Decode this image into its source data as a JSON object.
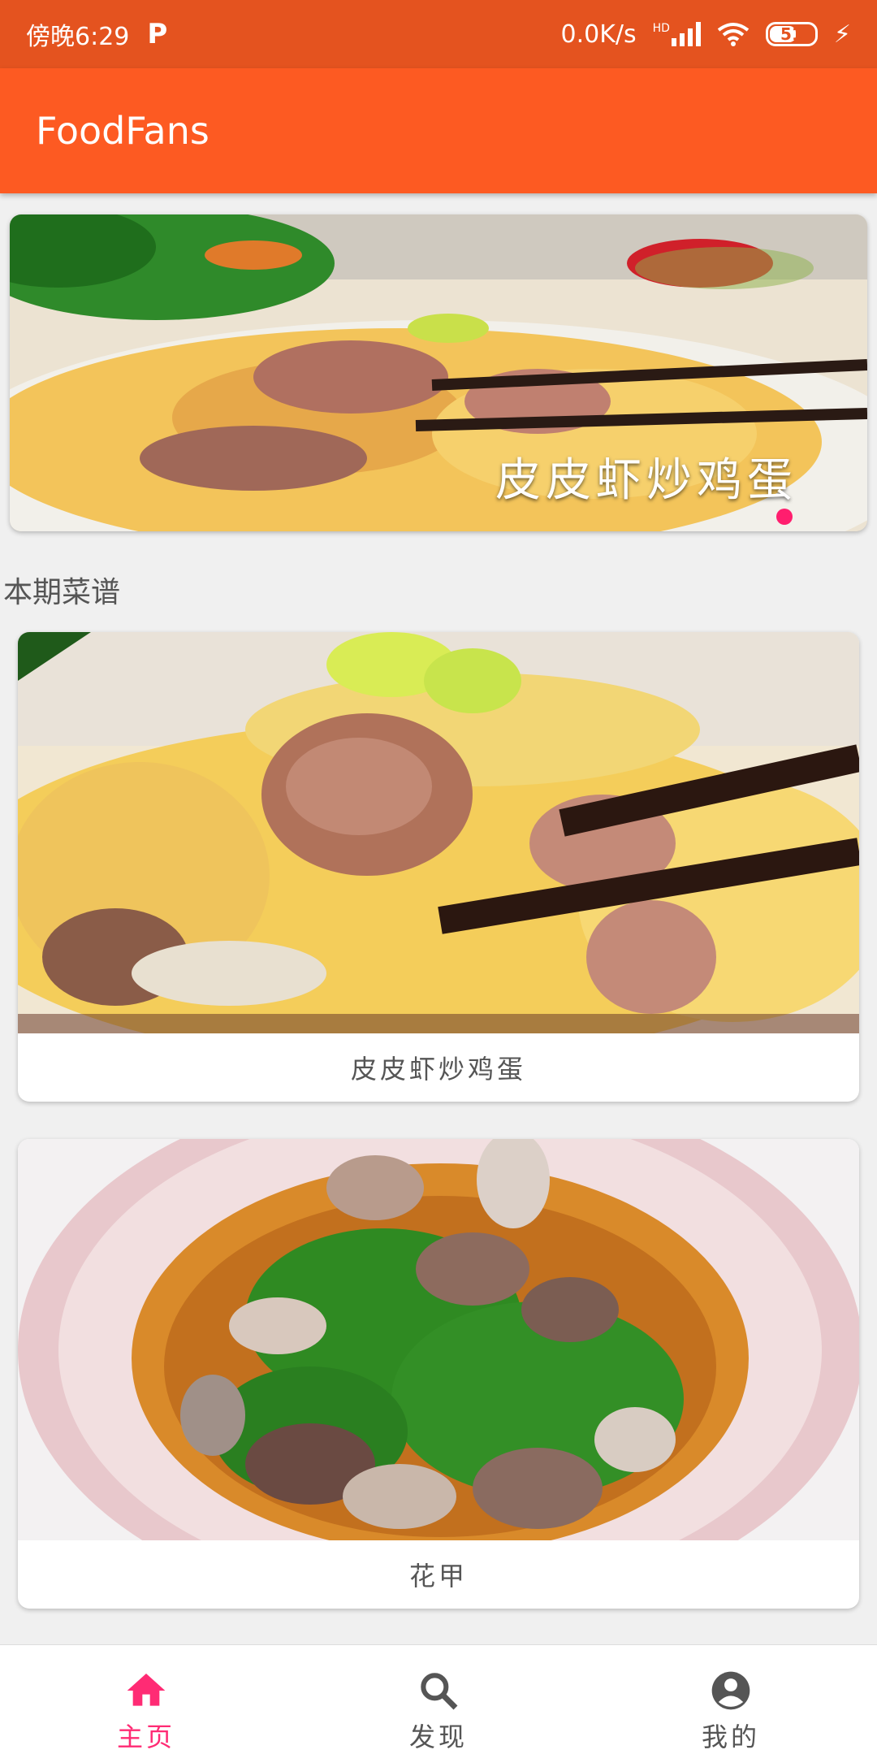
{
  "status_bar": {
    "time": "傍晚6:29",
    "speed": "0.0K/s",
    "hd": "HD",
    "battery": "51"
  },
  "app_bar": {
    "title": "FoodFans"
  },
  "banner": {
    "caption": "皮皮虾炒鸡蛋",
    "active_index": 0,
    "dot_color": "#ff1e6e"
  },
  "section": {
    "title": "本期菜谱"
  },
  "recipes": [
    {
      "name": "皮皮虾炒鸡蛋"
    },
    {
      "name": "花甲"
    }
  ],
  "bottom_nav": {
    "items": [
      {
        "label": "主页",
        "icon": "home-icon",
        "active": true
      },
      {
        "label": "发现",
        "icon": "search-icon",
        "active": false
      },
      {
        "label": "我的",
        "icon": "account-icon",
        "active": false
      }
    ]
  },
  "colors": {
    "status_bar": "#e4531f",
    "app_bar": "#fd5a22",
    "accent": "#ff2b74"
  }
}
